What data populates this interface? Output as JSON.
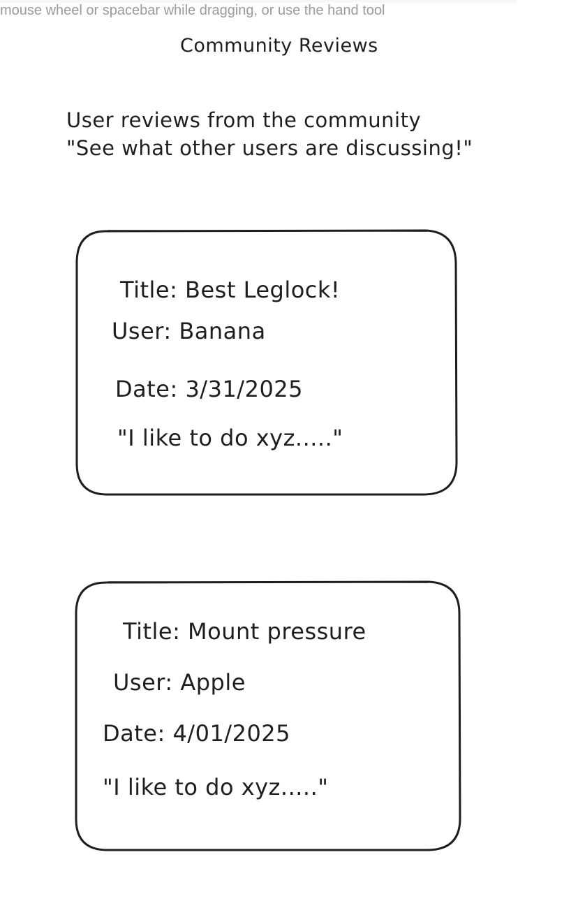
{
  "canvas_hint": "mouse wheel or spacebar while dragging, or use the hand tool",
  "page_title": "Community Reviews",
  "subtitle": {
    "line1": "User reviews from the community",
    "line2": "\"See what other users are discussing!\""
  },
  "reviews": [
    {
      "title": "Title: Best Leglock!",
      "user": "User: Banana",
      "date": "Date: 3/31/2025",
      "quote": "\"I like to do xyz.....\""
    },
    {
      "title": "Title: Mount pressure",
      "user": "User: Apple",
      "date": "Date: 4/01/2025",
      "quote": "\"I like to do xyz.....\""
    }
  ]
}
